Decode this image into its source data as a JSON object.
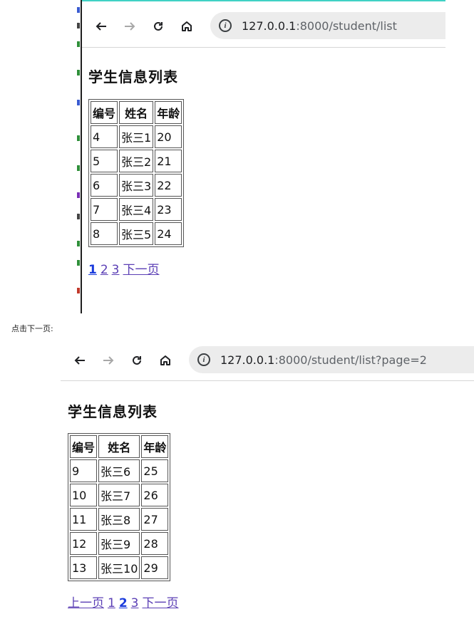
{
  "shot1": {
    "nav": {
      "back_icon": "arrow-left-icon",
      "forward_icon": "arrow-right-icon",
      "reload_icon": "reload-icon",
      "home_icon": "home-icon",
      "info_icon": "site-info-icon"
    },
    "url_host": "127.0.0.1",
    "url_rest": ":8000/student/list",
    "heading": "学生信息列表",
    "columns": [
      "编号",
      "姓名",
      "年龄"
    ],
    "rows": [
      [
        "4",
        "张三1",
        "20"
      ],
      [
        "5",
        "张三2",
        "21"
      ],
      [
        "6",
        "张三3",
        "22"
      ],
      [
        "7",
        "张三4",
        "23"
      ],
      [
        "8",
        "张三5",
        "24"
      ]
    ],
    "pager": {
      "current": "1",
      "page2": "2",
      "page3": "3",
      "next": "下一页"
    }
  },
  "caption": "点击下一页:",
  "shot2": {
    "url_host": "127.0.0.1",
    "url_rest": ":8000/student/list?page=2",
    "heading": "学生信息列表",
    "columns": [
      "编号",
      "姓名",
      "年龄"
    ],
    "rows": [
      [
        "9",
        "张三6",
        "25"
      ],
      [
        "10",
        "张三7",
        "26"
      ],
      [
        "11",
        "张三8",
        "27"
      ],
      [
        "12",
        "张三9",
        "28"
      ],
      [
        "13",
        "张三10",
        "29"
      ]
    ],
    "pager": {
      "prev": "上一页",
      "page1": "1",
      "current": "2",
      "page3": "3",
      "next": "下一页"
    }
  },
  "colors": {
    "link": "#5b3fb5",
    "current_page": "#1a3bdc",
    "urlbar_bg": "#ececec"
  }
}
